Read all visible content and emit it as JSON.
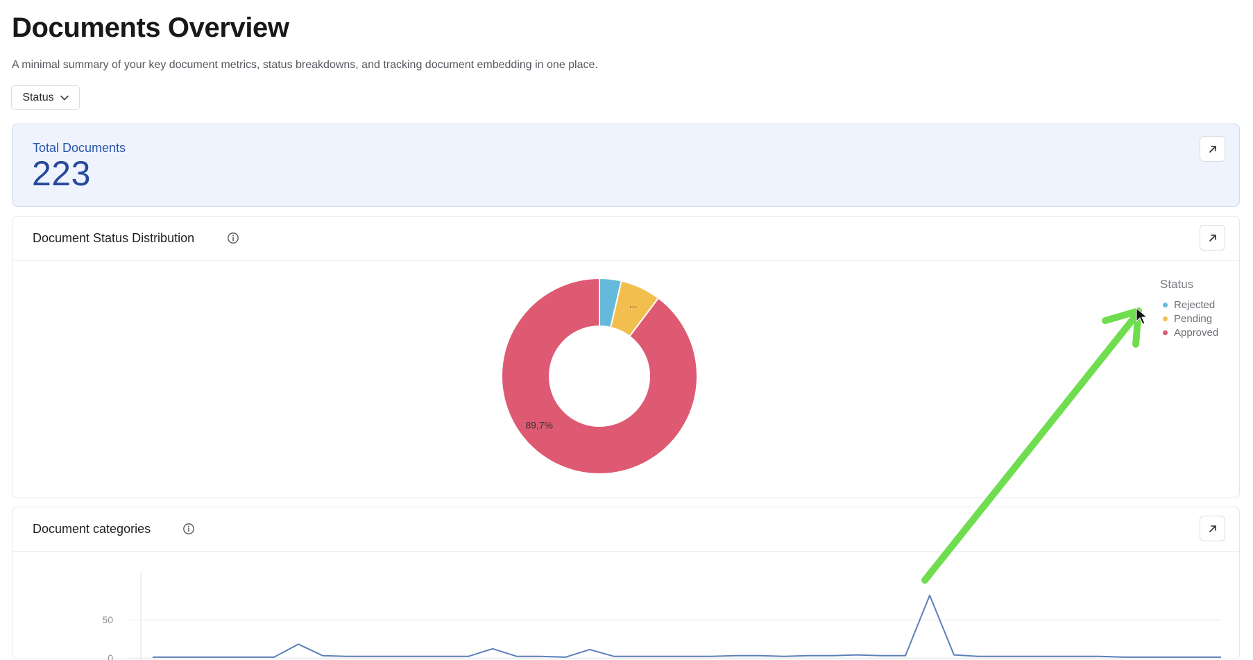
{
  "page": {
    "title": "Documents Overview",
    "subtitle": "A minimal summary of your key document metrics, status breakdowns, and tracking document embedding in one place."
  },
  "filter": {
    "label": "Status",
    "icon": "chevron-down-icon"
  },
  "kpi": {
    "label": "Total Documents",
    "value": "223",
    "action_icon": "arrow-up-right-icon"
  },
  "status_card": {
    "title": "Document Status Distribution",
    "info_icon": "info-icon",
    "action_icon": "arrow-up-right-icon"
  },
  "categories_card": {
    "title": "Document categories",
    "info_icon": "info-icon",
    "action_icon": "arrow-up-right-icon"
  },
  "annotation": {
    "arrow_color": "#6fdd4f",
    "shape": "arrow-overlay"
  },
  "chart_data": [
    {
      "type": "pie",
      "variant": "donut",
      "legend_title": "Status",
      "legend_position": "right",
      "slices": [
        {
          "name": "Rejected",
          "value": 3.6,
          "color": "#65b9db",
          "label": ""
        },
        {
          "name": "Pending",
          "value": 6.7,
          "color": "#f2bf4f",
          "label": "..."
        },
        {
          "name": "Approved",
          "value": 89.7,
          "color": "#dd5a72",
          "label": "89,7%"
        }
      ]
    },
    {
      "type": "line",
      "color": "#5b7fb7",
      "grid": true,
      "ylim": [
        0,
        80
      ],
      "yticks": [
        0,
        50
      ],
      "x": [
        1,
        2,
        3,
        4,
        5,
        6,
        7,
        8,
        9,
        10,
        11,
        12,
        13,
        14,
        15,
        16,
        17,
        18,
        19,
        20,
        21,
        22,
        23,
        24,
        25,
        26,
        27,
        28,
        29,
        30,
        31,
        32,
        33,
        34,
        35,
        36,
        37,
        38,
        39,
        40,
        41,
        42,
        43,
        44,
        45
      ],
      "series": [
        {
          "name": "",
          "values": [
            1,
            1,
            1,
            1,
            1,
            1,
            18,
            3,
            2,
            2,
            2,
            2,
            2,
            2,
            12,
            2,
            2,
            1,
            11,
            2,
            2,
            2,
            2,
            2,
            3,
            3,
            2,
            3,
            3,
            4,
            3,
            3,
            82,
            4,
            2,
            2,
            2,
            2,
            2,
            2,
            1,
            1,
            1,
            1,
            1
          ]
        }
      ]
    }
  ]
}
